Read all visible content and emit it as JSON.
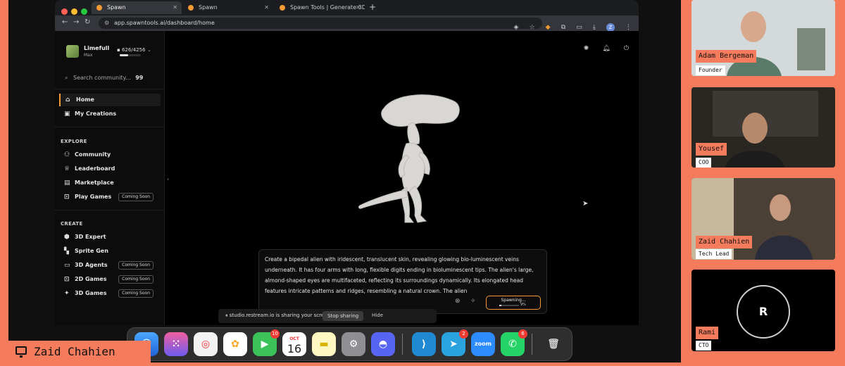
{
  "browser": {
    "tabs": [
      {
        "label": "Spawn",
        "active": true
      },
      {
        "label": "Spawn",
        "active": false
      },
      {
        "label": "Spawn Tools | Generate 3D A",
        "active": false
      }
    ],
    "url": "app.spawntools.ai/dashboard/home",
    "profile_initial": "Z"
  },
  "sidebar": {
    "workspace_name": "Limefull",
    "workspace_plan": "Max",
    "credits": "▪ 626/4256",
    "credits_fraction": 0.4,
    "search_placeholder": "Search community...",
    "search_shortcut": "99",
    "main_items": [
      {
        "label": "Home",
        "icon": "home-icon",
        "active": true
      },
      {
        "label": "My Creations",
        "icon": "creations-icon",
        "active": false
      }
    ],
    "explore_title": "EXPLORE",
    "explore_items": [
      {
        "label": "Community",
        "icon": "community-icon",
        "badge": ""
      },
      {
        "label": "Leaderboard",
        "icon": "trophy-icon",
        "badge": ""
      },
      {
        "label": "Marketplace",
        "icon": "store-icon",
        "badge": ""
      },
      {
        "label": "Play Games",
        "icon": "gamepad-icon",
        "badge": "Coming Soon"
      }
    ],
    "create_title": "CREATE",
    "create_items": [
      {
        "label": "3D Expert",
        "icon": "cube-icon",
        "badge": ""
      },
      {
        "label": "Sprite Gen",
        "icon": "sprite-icon",
        "badge": ""
      },
      {
        "label": "3D Agents",
        "icon": "agents-icon",
        "badge": "Coming Soon"
      },
      {
        "label": "2D Games",
        "icon": "gamepad-icon",
        "badge": "Coming Soon"
      },
      {
        "label": "3D Games",
        "icon": "wand-icon",
        "badge": "Coming Soon"
      }
    ]
  },
  "prompt": {
    "text": "Create a bipedal alien with iridescent, translucent skin, revealing glowing bio-luminescent veins underneath. It has four arms with long, flexible digits ending in bioluminescent tips. The alien's large, almond-shaped eyes are multifaceted, reflecting its surroundings dynamically. Its elongated head features intricate patterns and ridges, resembling a natural crown. The alien",
    "spawn_label": "Spawning...",
    "progress_pct": "9%",
    "progress_fraction": 0.09
  },
  "share_bar": {
    "text": "studio.restream.io is sharing your screen.",
    "stop": "Stop sharing",
    "hide": "Hide"
  },
  "dock": {
    "calendar_month": "OCT",
    "calendar_day": "16",
    "facetime_badge": "10",
    "telegram_badge": "2",
    "whatsapp_badge": "6",
    "zoom_label": "zoom"
  },
  "presenter": "Zaid Chahien",
  "participants": [
    {
      "name": "Adam Bergeman",
      "role": "Founder"
    },
    {
      "name": "Yousef",
      "role": "COO"
    },
    {
      "name": "Zaid Chahien",
      "role": "Tech Lead"
    },
    {
      "name": "Rami",
      "role": "CTO",
      "initial": "R"
    }
  ],
  "colors": {
    "accent": "#f47b5c",
    "brand": "#f39a33"
  }
}
